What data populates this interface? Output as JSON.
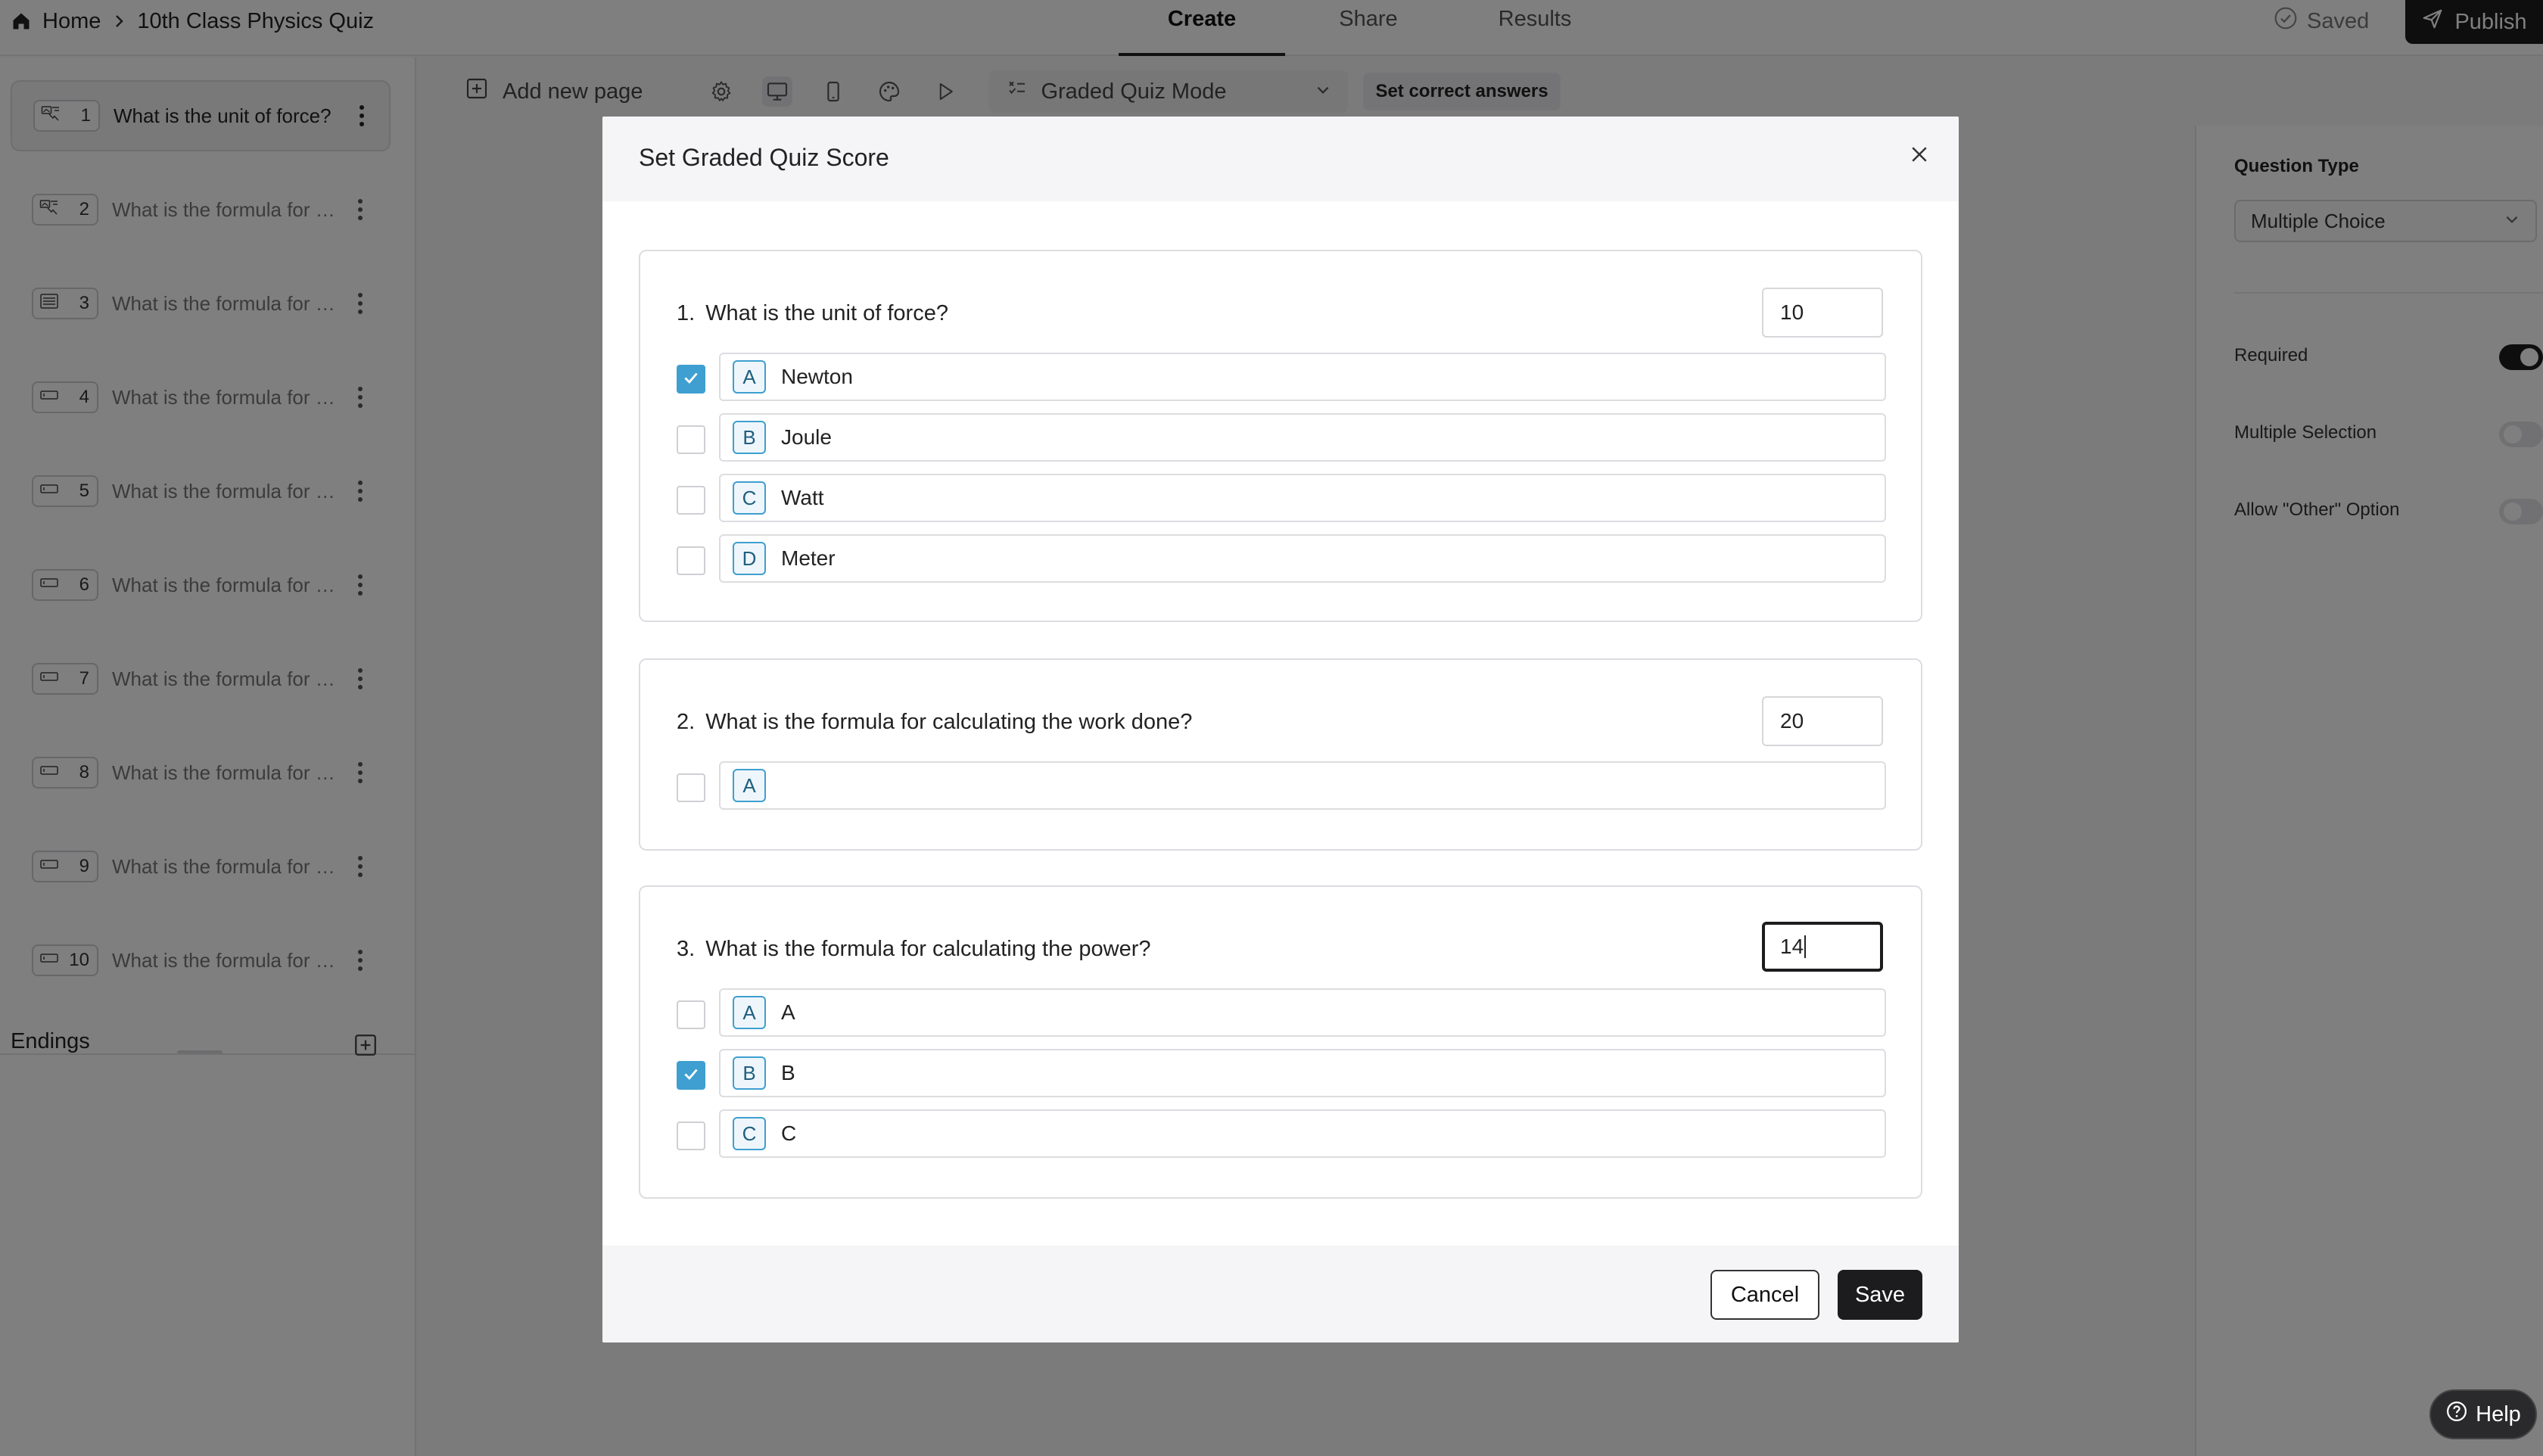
{
  "header": {
    "breadcrumb": {
      "home": "Home",
      "current": "10th Class Physics Quiz"
    },
    "tabs": [
      {
        "label": "Create"
      },
      {
        "label": "Share"
      },
      {
        "label": "Results"
      }
    ],
    "status": "Saved",
    "publish_label": "Publish"
  },
  "sidebar": {
    "pages": [
      {
        "number": "1",
        "title": "What is the unit of force?",
        "type_icon": "picture-choice-icon",
        "selected": true
      },
      {
        "number": "2",
        "title": "What is the formula for calculating the work done?",
        "type_icon": "picture-choice-icon"
      },
      {
        "number": "3",
        "title": "What is the formula for calculating the power?",
        "type_icon": "list-icon"
      },
      {
        "number": "4",
        "title": "What is the formula for calculating the momentum?",
        "type_icon": "short-text-icon"
      },
      {
        "number": "5",
        "title": "What is the formula for calculating the pressure?",
        "type_icon": "short-text-icon"
      },
      {
        "number": "6",
        "title": "What is the formula for calculating the density?",
        "type_icon": "short-text-icon"
      },
      {
        "number": "7",
        "title": "What is the formula for calculating the speed?",
        "type_icon": "short-text-icon"
      },
      {
        "number": "8",
        "title": "What is the formula for calculating the acceleration?",
        "type_icon": "short-text-icon"
      },
      {
        "number": "9",
        "title": "What is the formula for calculating the kinetic energy?",
        "type_icon": "short-text-icon"
      },
      {
        "number": "10",
        "title": "What is the formula for calculating the potential energy?",
        "type_icon": "short-text-icon"
      }
    ],
    "endings_label": "Endings"
  },
  "toolbar": {
    "add_page_label": "Add new page",
    "mode_label": "Graded Quiz Mode",
    "set_answers_label": "Set correct answers"
  },
  "properties": {
    "question_type_label": "Question Type",
    "question_type_value": "Multiple Choice",
    "required_label": "Required",
    "required": true,
    "multiple_selection_label": "Multiple Selection",
    "multiple_selection": false,
    "allow_other_label": "Allow \"Other\" Option",
    "allow_other": false
  },
  "modal": {
    "title": "Set Graded Quiz Score",
    "questions": [
      {
        "number": "1.",
        "text": "What is the unit of force?",
        "score": "10",
        "options": [
          {
            "letter": "A",
            "text": "Newton",
            "correct": true
          },
          {
            "letter": "B",
            "text": "Joule",
            "correct": false
          },
          {
            "letter": "C",
            "text": "Watt",
            "correct": false
          },
          {
            "letter": "D",
            "text": "Meter",
            "correct": false
          }
        ]
      },
      {
        "number": "2.",
        "text": "What is the formula for calculating the work done?",
        "score": "20",
        "options": [
          {
            "letter": "A",
            "text": "",
            "correct": false
          }
        ]
      },
      {
        "number": "3.",
        "text": "What is the formula for calculating the power?",
        "score": "14",
        "options": [
          {
            "letter": "A",
            "text": "A",
            "correct": false
          },
          {
            "letter": "B",
            "text": "B",
            "correct": true
          },
          {
            "letter": "C",
            "text": "C",
            "correct": false
          }
        ]
      }
    ],
    "cancel_label": "Cancel",
    "save_label": "Save"
  },
  "help_label": "Help",
  "colors": {
    "accent": "#3e9fd0",
    "primary_dark": "#1c1c1e"
  }
}
